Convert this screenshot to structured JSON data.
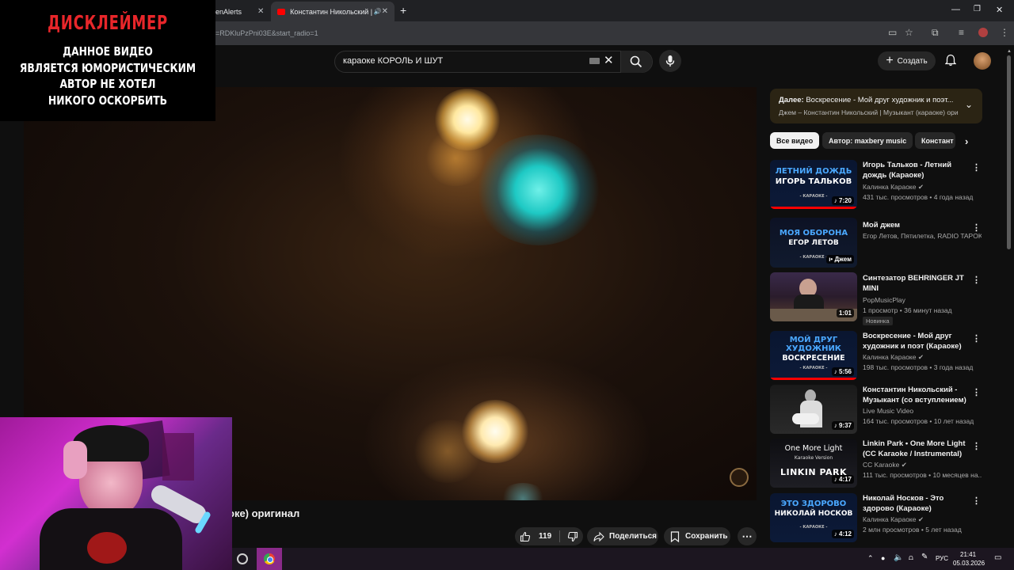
{
  "browser": {
    "tabs": [
      {
        "label": "enAlerts"
      },
      {
        "label": "Константин Никольский | "
      }
    ],
    "url": "=RDKluPzPni03E&start_radio=1"
  },
  "disclaimer": {
    "title": "ДИСКЛЕЙМЕР",
    "lines": [
      "ДАННОЕ ВИДЕО",
      "ЯВЛЯЕТСЯ ЮМОРИСТИЧЕСКИМ",
      "АВТОР НЕ ХОТЕЛ",
      "НИКОГО ОСКОРБИТЬ"
    ]
  },
  "header": {
    "search_value": "караоке КОРОЛЬ И ШУТ",
    "create_label": "Создать"
  },
  "video": {
    "title_fragment": "оке) оригинал",
    "likes": "119",
    "share_label": "Поделиться",
    "save_label": "Сохранить"
  },
  "up_next": {
    "prefix": "Далее:",
    "title": "Воскресение - Мой друг художник и поэт...",
    "subtitle": "Джем – Константин Никольский | Музыкант (караоке) ори"
  },
  "chips": [
    "Все видео",
    "Автор: maxbery music",
    "Констант"
  ],
  "sidebar_items": [
    {
      "title": "Игорь Тальков - Летний дождь (Караоке)",
      "channel": "Калинка Караоке",
      "meta": "431 тыс. просмотров • 4 года назад",
      "duration": "7:20",
      "thumb_line1": "ЛЕТНИЙ ДОЖДЬ",
      "thumb_line2": "ИГОРЬ ТАЛЬКОВ",
      "thumb_tag": "- КАРАОКЕ -"
    },
    {
      "title": "Мой джем",
      "channel": "Егор Летов, Пятилетка, RADIO TAPOK ...",
      "meta": "",
      "duration": "Джем",
      "thumb_line1": "МОЯ ОБОРОНА",
      "thumb_line2": "ЕГОР ЛЕТОВ",
      "thumb_tag": "- КАРАОКЕ -"
    },
    {
      "title": "Синтезатор BEHRINGER JT MINI",
      "channel": "PopMusicPlay",
      "meta": "1 просмотр • 36 минут назад",
      "duration": "1:01",
      "badge": "Новинка"
    },
    {
      "title": "Воскресение - Мой друг художник и поэт (Караоке)",
      "channel": "Калинка Караоке",
      "meta": "198 тыс. просмотров • 3 года назад",
      "duration": "5:56",
      "thumb_line1": "МОЙ ДРУГ",
      "thumb_line2": "ХУДОЖНИК",
      "thumb_line3": "ВОСКРЕСЕНИЕ",
      "thumb_tag": "- КАРАОКЕ -"
    },
    {
      "title": "Константин Никольский - Музыкант (со вступлением)",
      "channel": "Live Music Video",
      "meta": "164 тыс. просмотров • 10 лет назад",
      "duration": "9:37"
    },
    {
      "title": "Linkin Park • One More Light (CC Karaoke / Instrumental)",
      "channel": "CC Karaoke",
      "meta": "111 тыс. просмотров • 10 месяцев на...",
      "duration": "4:17",
      "thumb_line1": "One More Light",
      "thumb_line2": "Karaoke Version",
      "thumb_line3": "LINKIN PARK"
    },
    {
      "title": "Николай Носков - Это здорово (Караоке)",
      "channel": "Калинка Караоке",
      "meta": "2 млн просмотров • 5 лет назад",
      "duration": "4:12",
      "thumb_line1": "ЭТО ЗДОРОВО",
      "thumb_line2": "НИКОЛАЙ НОСКОВ",
      "thumb_tag": "- КАРАОКЕ -"
    }
  ],
  "taskbar": {
    "lang": "РУС",
    "time": "21:41",
    "date": "05.03.2026"
  },
  "colors": {
    "accent_red": "#ff0000",
    "disclaimer_red": "#e8262a",
    "background": "#0f0f0f"
  },
  "icons": [
    "search-icon",
    "mic-icon",
    "bell-icon",
    "like-icon",
    "dislike-icon",
    "share-icon",
    "save-icon",
    "more-icon",
    "chevron-down-icon",
    "chevron-right-icon",
    "close-icon",
    "keyboard-icon"
  ]
}
